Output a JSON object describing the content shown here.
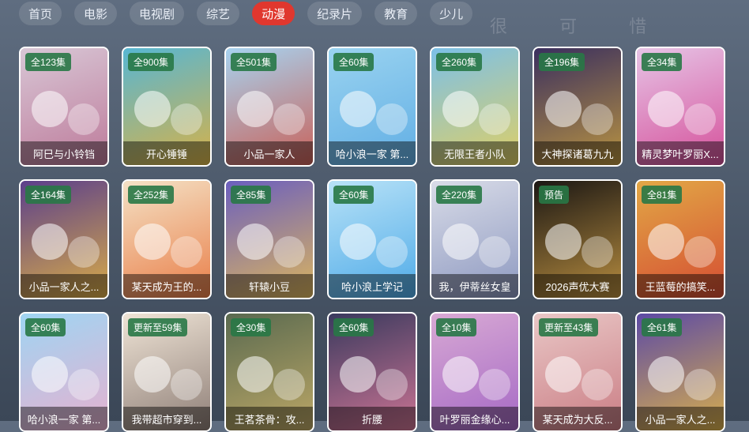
{
  "nav": {
    "tabs": [
      {
        "label": "首页",
        "active": false
      },
      {
        "label": "电影",
        "active": false
      },
      {
        "label": "电视剧",
        "active": false
      },
      {
        "label": "综艺",
        "active": false
      },
      {
        "label": "动漫",
        "active": true
      },
      {
        "label": "纪录片",
        "active": false
      },
      {
        "label": "教育",
        "active": false
      },
      {
        "label": "少儿",
        "active": false
      }
    ]
  },
  "background": {
    "faint_text": "很 可 惜"
  },
  "cards": [
    {
      "badge": "全123集",
      "title": "阿巳与小铃铛",
      "bg": "#d8c7d6",
      "accent": "#b86b8e"
    },
    {
      "badge": "全900集",
      "title": "开心锤锤",
      "bg": "#57b6d3",
      "accent": "#f0b12d"
    },
    {
      "badge": "全501集",
      "title": "小品一家人",
      "bg": "#a7d3f0",
      "accent": "#d04a3a"
    },
    {
      "badge": "全60集",
      "title": "哈小浪一家 第...",
      "bg": "#9ad3f0",
      "accent": "#56a7e2"
    },
    {
      "badge": "全260集",
      "title": "无限王者小队",
      "bg": "#7cc0e8",
      "accent": "#f2d24b"
    },
    {
      "badge": "全196集",
      "title": "大神探诸葛九九",
      "bg": "#3a2f5f",
      "accent": "#d3a83b"
    },
    {
      "badge": "全34集",
      "title": "精灵梦叶罗丽X...",
      "bg": "#e6c4e6",
      "accent": "#d23a8c"
    },
    {
      "badge": "全164集",
      "title": "小品一家人之...",
      "bg": "#5b3f8c",
      "accent": "#f2c13a"
    },
    {
      "badge": "全252集",
      "title": "某天成为王的...",
      "bg": "#f4e2c6",
      "accent": "#e76a2f"
    },
    {
      "badge": "全85集",
      "title": "轩辕小豆",
      "bg": "#6b5fbf",
      "accent": "#f2c64a"
    },
    {
      "badge": "全60集",
      "title": "哈小浪上学记",
      "bg": "#b8e2f7",
      "accent": "#3aa0e5"
    },
    {
      "badge": "全220集",
      "title": "我，伊蒂丝女皇",
      "bg": "#d9dce8",
      "accent": "#7e8bb8"
    },
    {
      "badge": "预告",
      "title": "2026声优大赛",
      "bg": "#1b1714",
      "accent": "#d7a548"
    },
    {
      "badge": "全81集",
      "title": "王蓝莓的搞笑...",
      "bg": "#e2a846",
      "accent": "#d23b2e"
    },
    {
      "badge": "全60集",
      "title": "哈小浪一家 第...",
      "bg": "#9fd5f3",
      "accent": "#f4a9c8"
    },
    {
      "badge": "更新至59集",
      "title": "我带超市穿到...",
      "bg": "#efe4d6",
      "accent": "#7b6a64"
    },
    {
      "badge": "全30集",
      "title": "王茗茶骨：攻...",
      "bg": "#5a6a50",
      "accent": "#cfb36a"
    },
    {
      "badge": "全60集",
      "title": "折腰",
      "bg": "#3a3a5e",
      "accent": "#e87f9e"
    },
    {
      "badge": "全10集",
      "title": "叶罗丽金缘心...",
      "bg": "#d8a9d4",
      "accent": "#9b5cc2"
    },
    {
      "badge": "更新至43集",
      "title": "某天成为大反...",
      "bg": "#e9c7c6",
      "accent": "#c46e77"
    },
    {
      "badge": "全61集",
      "title": "小品一家人之...",
      "bg": "#5c4aa5",
      "accent": "#f1c33b"
    }
  ]
}
